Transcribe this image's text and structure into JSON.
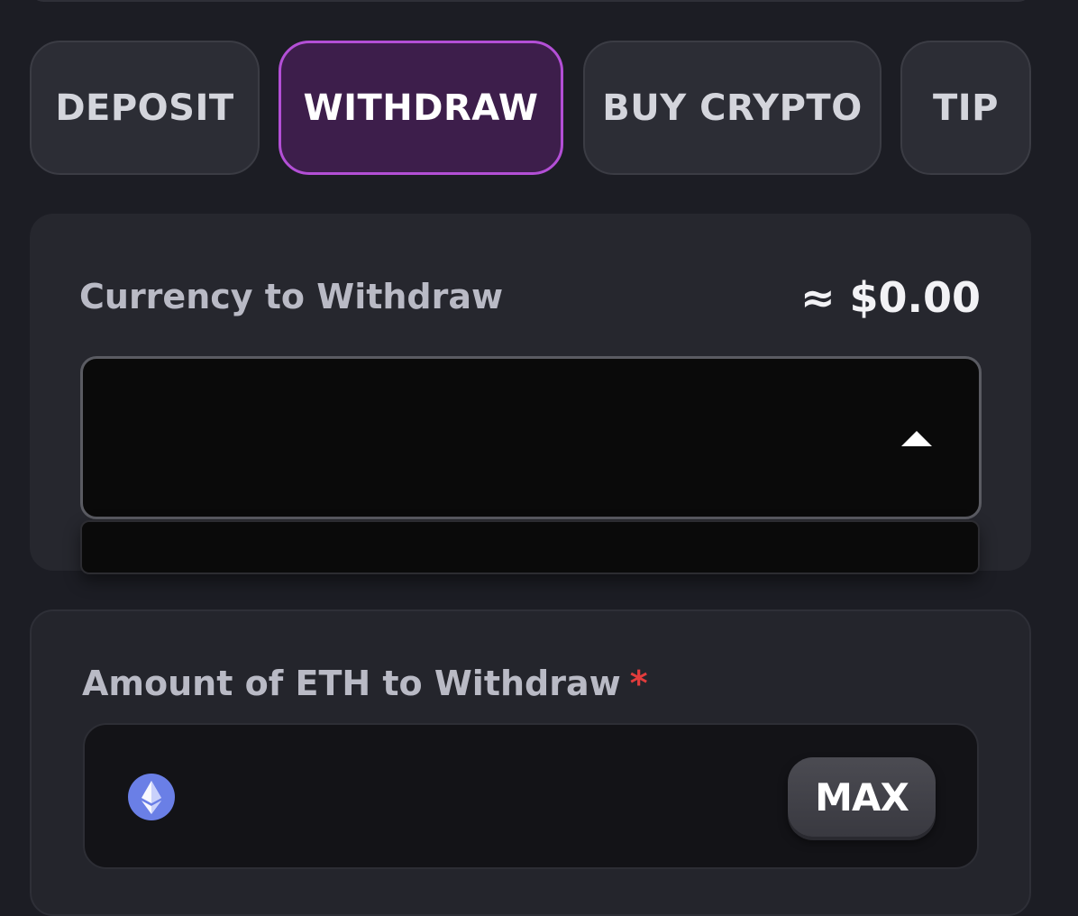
{
  "tabs": [
    {
      "label": "DEPOSIT",
      "active": false
    },
    {
      "label": "WITHDRAW",
      "active": true
    },
    {
      "label": "BUY CRYPTO",
      "active": false
    },
    {
      "label": "TIP",
      "active": false
    }
  ],
  "currency_section": {
    "label": "Currency to Withdraw",
    "usd_value": "≈ $0.00",
    "select_value": "",
    "caret_icon": "caret-up-icon"
  },
  "amount_section": {
    "label": "Amount of ETH to Withdraw",
    "required_mark": "*",
    "input_value": "",
    "coin_icon": "ethereum-icon",
    "max_label": "MAX"
  },
  "colors": {
    "accent": "#b34fd6",
    "active_tab_bg": "#3d1e4b",
    "required": "#e23c3c",
    "eth": "#6a7fe6"
  }
}
